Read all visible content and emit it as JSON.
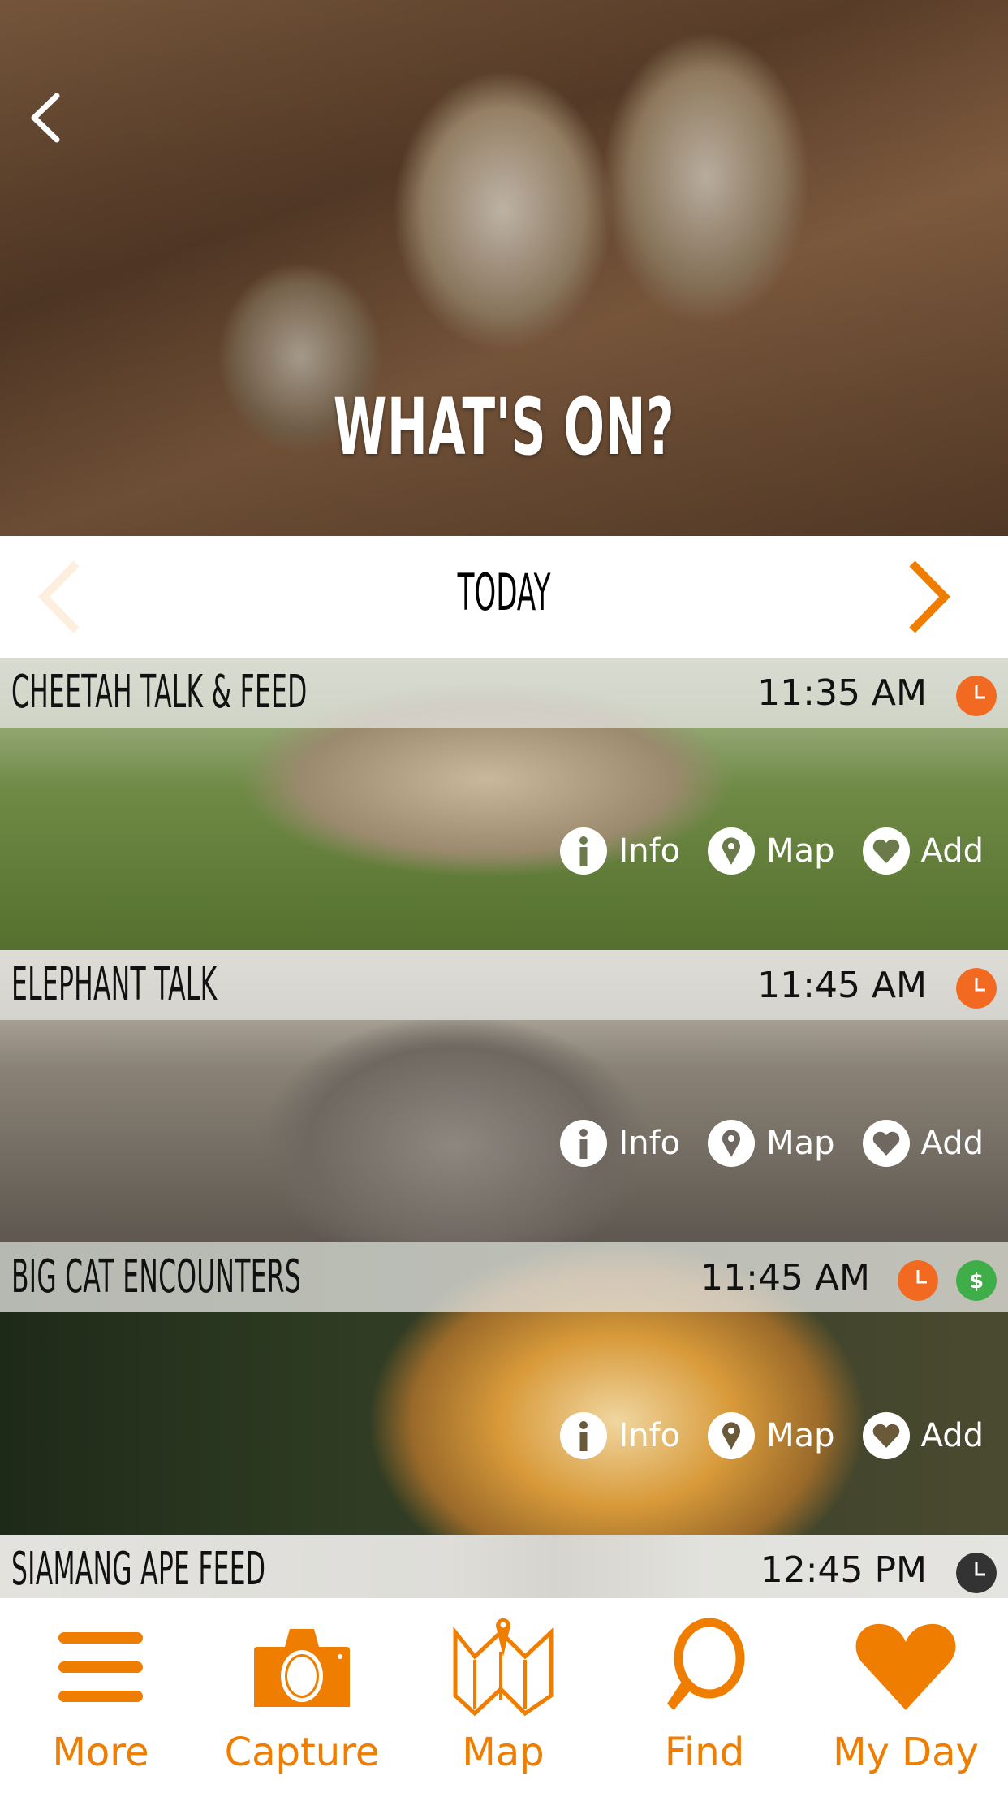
{
  "header": {
    "title": "WHAT'S ON?",
    "back_icon": "chevron-left-icon"
  },
  "day_selector": {
    "label": "TODAY",
    "prev_icon": "chevron-left-icon",
    "next_icon": "chevron-right-icon",
    "prev_enabled": false,
    "next_enabled": true
  },
  "colors": {
    "accent": "#ef7d00",
    "clock_orange": "#f26a21",
    "clock_dark": "#333333",
    "dollar_green": "#3fae49"
  },
  "events": [
    {
      "title": "CHEETAH TALK & FEED",
      "time": "11:35 AM",
      "badges": [
        "clock-orange"
      ],
      "actions": [
        {
          "label": "Info",
          "icon": "info-icon"
        },
        {
          "label": "Map",
          "icon": "map-pin-icon"
        },
        {
          "label": "Add",
          "icon": "heart-icon"
        }
      ]
    },
    {
      "title": "ELEPHANT TALK",
      "time": "11:45 AM",
      "badges": [
        "clock-orange"
      ],
      "actions": [
        {
          "label": "Info",
          "icon": "info-icon"
        },
        {
          "label": "Map",
          "icon": "map-pin-icon"
        },
        {
          "label": "Add",
          "icon": "heart-icon"
        }
      ]
    },
    {
      "title": "BIG CAT ENCOUNTERS",
      "time": "11:45 AM",
      "badges": [
        "clock-orange",
        "dollar-green"
      ],
      "actions": [
        {
          "label": "Info",
          "icon": "info-icon"
        },
        {
          "label": "Map",
          "icon": "map-pin-icon"
        },
        {
          "label": "Add",
          "icon": "heart-icon"
        }
      ]
    },
    {
      "title": "SIAMANG APE FEED",
      "time": "12:45 PM",
      "badges": [
        "clock-dark"
      ],
      "actions": []
    }
  ],
  "tabbar": [
    {
      "label": "More",
      "icon": "menu-icon"
    },
    {
      "label": "Capture",
      "icon": "camera-icon"
    },
    {
      "label": "Map",
      "icon": "folded-map-icon"
    },
    {
      "label": "Find",
      "icon": "search-icon"
    },
    {
      "label": "My Day",
      "icon": "heart-icon"
    }
  ]
}
